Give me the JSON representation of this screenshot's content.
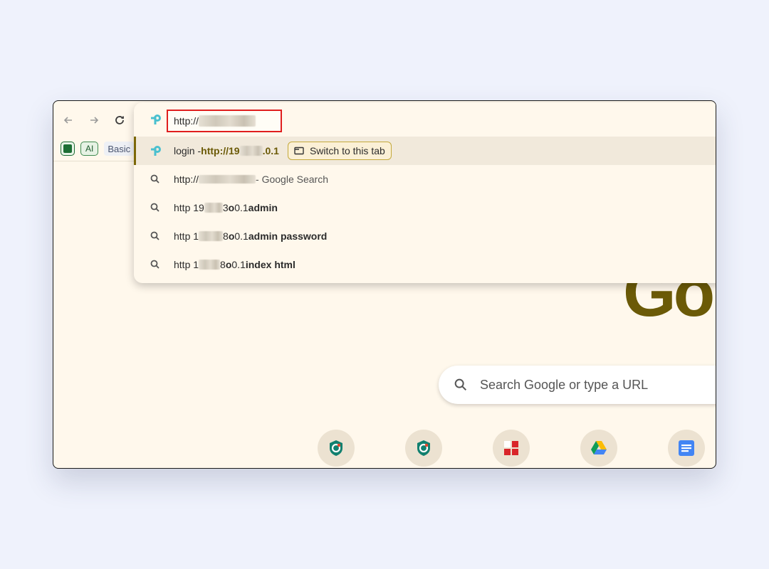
{
  "bookmarks": {
    "ai_label": "AI",
    "basic_label": "Basic"
  },
  "omnibox": {
    "input_value": "http://",
    "suggestions": [
      {
        "prefix": "login - ",
        "url": "http://19",
        "url_tail": ".0.1",
        "switch_label": "Switch to this tab"
      },
      {
        "text": "http://",
        "suffix": " - Google Search"
      },
      {
        "pre": "http 19",
        "mid": "3 ",
        "o": "o",
        "tail": " 0.1 ",
        "bold": "admin"
      },
      {
        "pre": "http 1",
        "mid": "8 ",
        "o": "o",
        "tail": " 0.1 ",
        "bold": "admin password"
      },
      {
        "pre": "http 1",
        "mid": "8 ",
        "o": "o",
        "tail": " 0.1 ",
        "bold": "index html"
      }
    ]
  },
  "ntp": {
    "logo_text": "Go",
    "search_placeholder": "Search Google or type a URL",
    "shortcuts": [
      "vpn-shield-icon",
      "vpn-shield-icon",
      "red-grid-icon",
      "google-drive-icon",
      "google-docs-icon"
    ]
  },
  "colors": {
    "page_bg": "#eff2fc",
    "window_bg": "#fff8ec",
    "accent": "#6b5a07",
    "highlight_border": "#e01e1e"
  }
}
